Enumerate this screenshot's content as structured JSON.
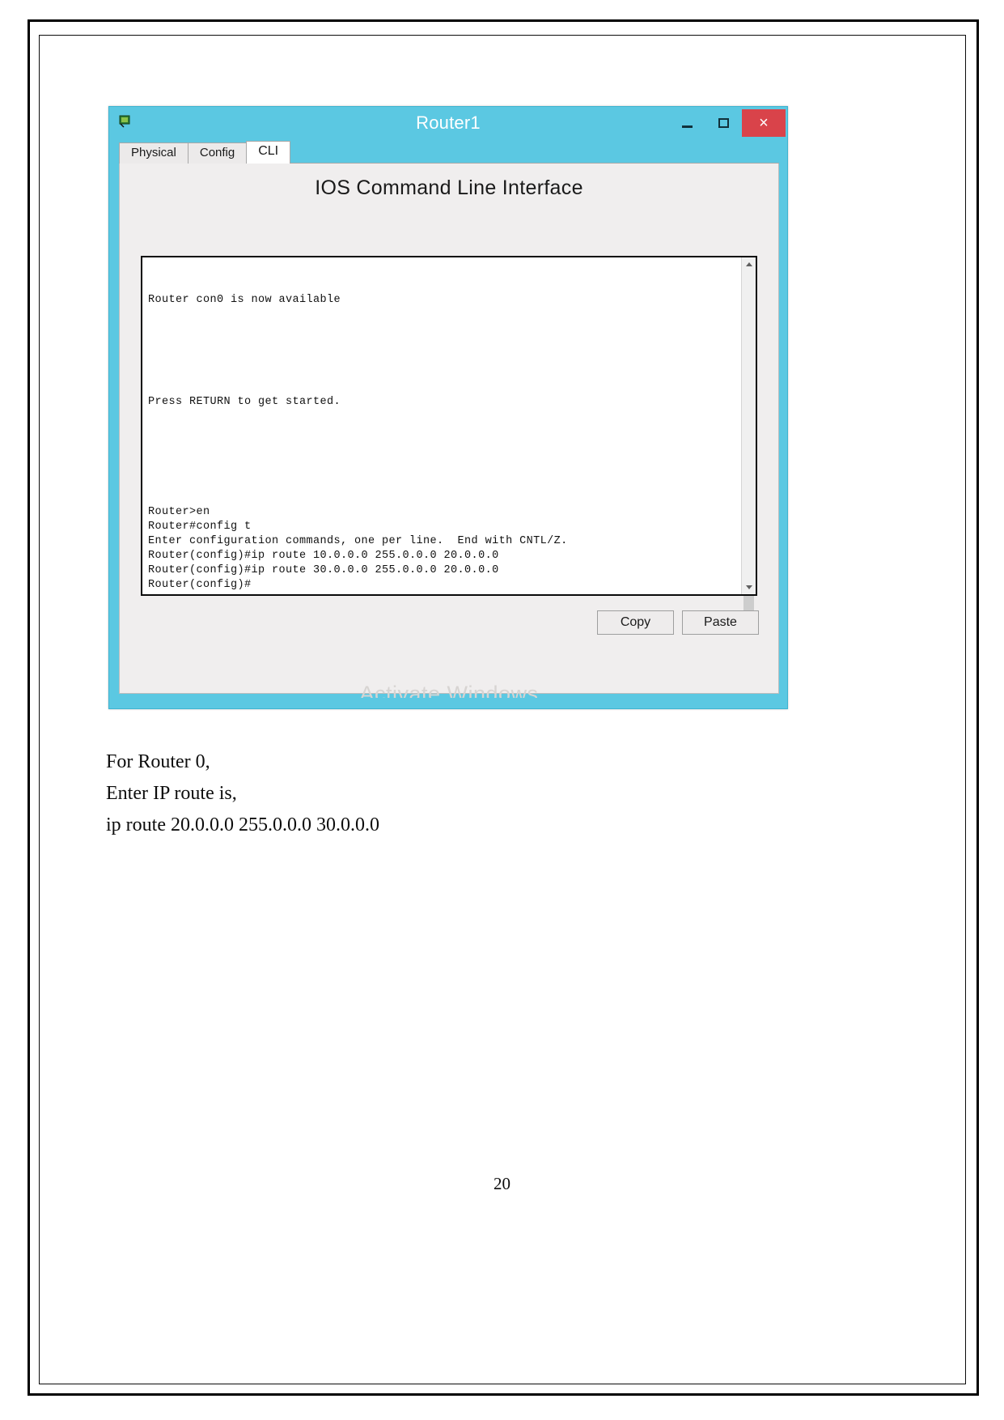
{
  "window": {
    "title": "Router1",
    "icon": "router-device-icon",
    "controls": {
      "minimize_label": "–",
      "maximize_label": "□",
      "close_label": "×"
    },
    "tabs": [
      {
        "label": "Physical",
        "active": false
      },
      {
        "label": "Config",
        "active": false
      },
      {
        "label": "CLI",
        "active": true
      }
    ],
    "heading": "IOS Command Line Interface",
    "buttons": {
      "copy_label": "Copy",
      "paste_label": "Paste"
    },
    "watermark": "Activate Windows"
  },
  "terminal": {
    "top_lines": [
      "Router con0 is now available"
    ],
    "middle_lines": [
      "Press RETURN to get started."
    ],
    "bottom_lines": [
      "Router>en",
      "Router#config t",
      "Enter configuration commands, one per line.  End with CNTL/Z.",
      "Router(config)#ip route 10.0.0.0 255.0.0.0 20.0.0.0",
      "Router(config)#ip route 30.0.0.0 255.0.0.0 20.0.0.0",
      "Router(config)#"
    ]
  },
  "document": {
    "lines": [
      "For Router 0,",
      "Enter IP route is,",
      "ip route 20.0.0.0 255.0.0.0 30.0.0.0"
    ],
    "page_number": "20"
  },
  "colors": {
    "titlebar": "#5bc8e2",
    "close_button": "#d9434a",
    "pane_background": "#f0eeee"
  }
}
